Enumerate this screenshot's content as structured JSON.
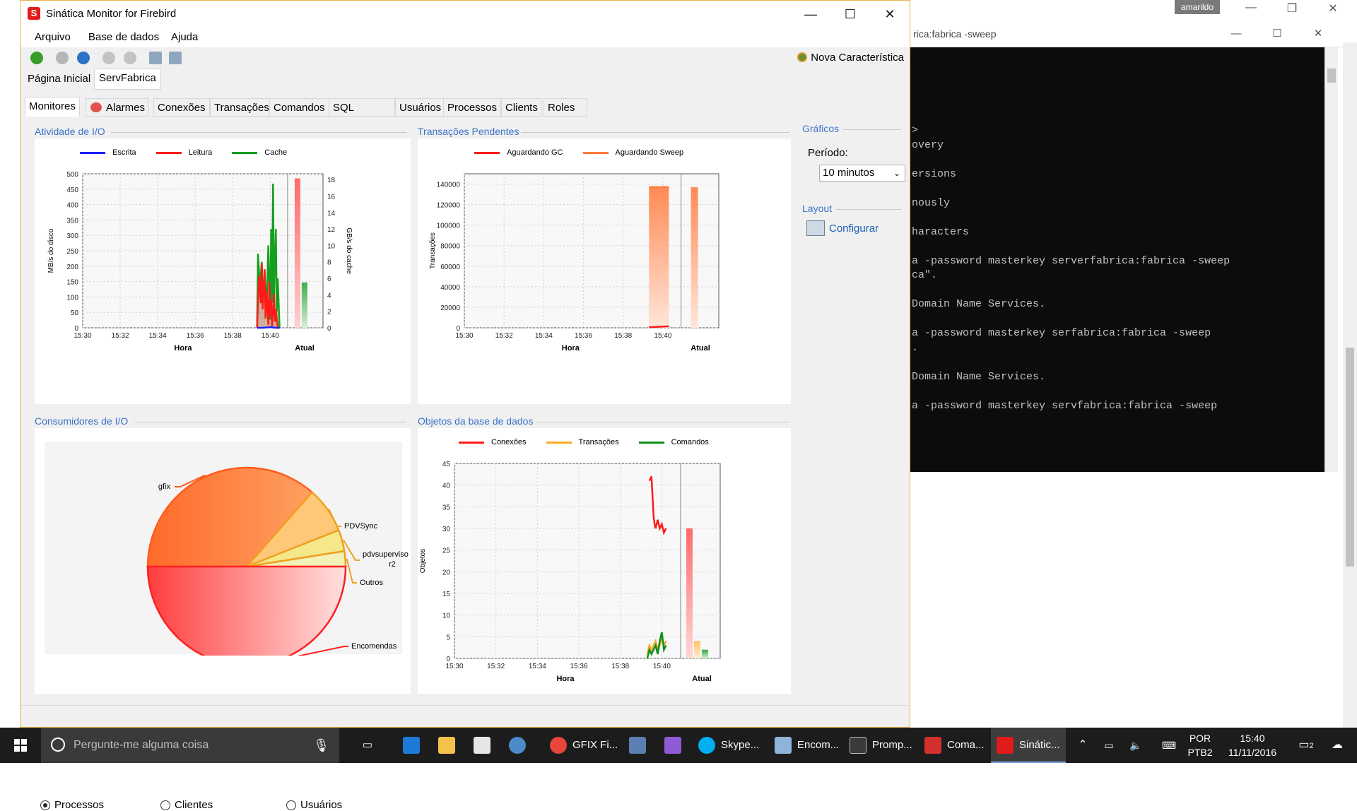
{
  "background": {
    "user_label": "amarildo",
    "console_title": "rica:fabrica -sweep",
    "console_lines": [
      ">",
      "overy",
      "",
      "ersions",
      "",
      "nously",
      "",
      "haracters",
      "",
      "a -password masterkey serverfabrica:fabrica -sweep",
      "ca\".",
      "",
      "Domain Name Services.",
      "",
      "a -password masterkey serfabrica:fabrica -sweep",
      ".",
      "",
      "Domain Name Services.",
      "",
      "a -password masterkey servfabrica:fabrica -sweep"
    ]
  },
  "window": {
    "title": "Sinática Monitor for Firebird",
    "menu": [
      "Arquivo",
      "Base de dados",
      "Ajuda"
    ],
    "nova_caracteristica": "Nova Característica",
    "doc_tabs": [
      "Página Inicial",
      "ServFabrica"
    ],
    "active_doc_tab": "ServFabrica",
    "main_tabs": [
      "Monitores",
      "Alarmes",
      "Conexões",
      "Transações",
      "Comandos",
      "SQL",
      "Usuários",
      "Processos",
      "Clients",
      "Roles"
    ],
    "active_main_tab": "Monitores"
  },
  "colors": {
    "accent_title": "#3c73c8",
    "escrita": "#1d1dff",
    "leitura": "#ff1a1a",
    "cache": "#14a01e",
    "aguardando_gc": "#ff1a1a",
    "aguardando_sweep": "#ff7a3d",
    "conexoes": "#ff1a1a",
    "transacoes": "#ffaa22",
    "comandos": "#0f8f1c"
  },
  "io_activity": {
    "title": "Atividade de I/O",
    "legend": [
      "Escrita",
      "Leitura",
      "Cache"
    ],
    "ylabel": "MB/s do disco",
    "y2label": "GB/s do cache",
    "xlabel": "Hora",
    "atual_label": "Atual"
  },
  "pending_tx": {
    "title": "Transações Pendentes",
    "legend": [
      "Aguardando GC",
      "Aguardando Sweep"
    ],
    "ylabel": "Transações",
    "xlabel": "Hora",
    "atual_label": "Atual"
  },
  "io_consumers": {
    "title": "Consumidores de I/O",
    "radio_options": [
      "Processos",
      "Clientes",
      "Usuários"
    ],
    "selected": "Processos"
  },
  "db_objects": {
    "title": "Objetos da base de dados",
    "legend": [
      "Conexões",
      "Transações",
      "Comandos"
    ],
    "ylabel": "Objetos",
    "xlabel": "Hora",
    "atual_label": "Atual"
  },
  "sidebar": {
    "graficos_title": "Gráficos",
    "periodo_label": "Período:",
    "periodo_value": "10 minutos",
    "layout_title": "Layout",
    "configurar_label": "Configurar"
  },
  "chart_data": [
    {
      "type": "line",
      "title": "Atividade de I/O",
      "xlabel": "Hora",
      "ylabel": "MB/s do disco",
      "y2label": "GB/s do cache",
      "x_ticks": [
        "15:30",
        "15:32",
        "15:34",
        "15:36",
        "15:38",
        "15:40"
      ],
      "y_ticks": [
        0,
        50,
        100,
        150,
        200,
        250,
        300,
        350,
        400,
        450,
        500
      ],
      "y2_ticks": [
        0,
        2,
        4,
        6,
        8,
        10,
        12,
        14,
        16,
        18
      ],
      "ylim": [
        0,
        500
      ],
      "y2lim": [
        0,
        18
      ],
      "xlim_minutes": [
        0,
        11
      ],
      "series": [
        {
          "name": "Escrita",
          "axis": "left",
          "x": [
            9.3,
            9.6,
            10.0,
            10.3,
            10.5
          ],
          "y": [
            0,
            0,
            2,
            0,
            0
          ]
        },
        {
          "name": "Leitura",
          "axis": "left",
          "x": [
            9.3,
            9.4,
            9.5,
            9.55,
            9.6,
            9.7,
            9.75,
            9.8,
            9.9,
            9.95,
            10.0,
            10.05,
            10.1,
            10.2,
            10.25,
            10.3,
            10.4,
            10.5
          ],
          "y": [
            0,
            170,
            80,
            210,
            60,
            190,
            30,
            120,
            10,
            150,
            40,
            90,
            5,
            110,
            20,
            60,
            0,
            0
          ]
        },
        {
          "name": "Cache",
          "axis": "right",
          "x": [
            9.3,
            9.35,
            9.45,
            9.55,
            9.6,
            9.7,
            9.8,
            9.9,
            10.0,
            10.05,
            10.1,
            10.15,
            10.2,
            10.3,
            10.35,
            10.4,
            10.5
          ],
          "y": [
            0,
            9,
            5,
            8,
            3,
            7,
            2,
            10,
            1,
            12,
            3,
            17.5,
            4,
            12,
            2,
            6,
            0
          ]
        }
      ],
      "current": [
        {
          "name": "Leitura",
          "value": 485
        },
        {
          "name": "Cache",
          "value": 5.5
        }
      ]
    },
    {
      "type": "area",
      "title": "Transações Pendentes",
      "xlabel": "Hora",
      "ylabel": "Transações",
      "x_ticks": [
        "15:30",
        "15:32",
        "15:34",
        "15:36",
        "15:38",
        "15:40"
      ],
      "y_ticks": [
        0,
        20000,
        40000,
        60000,
        80000,
        100000,
        120000,
        140000
      ],
      "ylim": [
        0,
        150000
      ],
      "series": [
        {
          "name": "Aguardando GC",
          "x": [
            9.3,
            10.3
          ],
          "y": [
            500,
            1500
          ]
        },
        {
          "name": "Aguardando Sweep",
          "x": [
            9.3,
            10.3
          ],
          "y": [
            137000,
            137000
          ]
        }
      ],
      "current": [
        {
          "name": "Aguardando GC",
          "value": 1000
        },
        {
          "name": "Aguardando Sweep",
          "value": 137000
        }
      ]
    },
    {
      "type": "pie",
      "title": "Consumidores de I/O",
      "slices": [
        {
          "label": "gfix",
          "value": 36.5,
          "color": "#ff7b2e"
        },
        {
          "label": "PDVSync",
          "value": 7.5,
          "color": "#ffc878"
        },
        {
          "label": "pdvsupervisor2",
          "value": 3.5,
          "color": "#f5e88a"
        },
        {
          "label": "Outros",
          "value": 2.5,
          "color": "#f2f2b8"
        },
        {
          "label": "Encomendas",
          "value": 50,
          "color": "#ff4d4d"
        }
      ]
    },
    {
      "type": "line",
      "title": "Objetos da base de dados",
      "xlabel": "Hora",
      "ylabel": "Objetos",
      "x_ticks": [
        "15:30",
        "15:32",
        "15:34",
        "15:36",
        "15:38",
        "15:40"
      ],
      "y_ticks": [
        0,
        5,
        10,
        15,
        20,
        25,
        30,
        35,
        40,
        45
      ],
      "ylim": [
        0,
        45
      ],
      "series": [
        {
          "name": "Conexões",
          "x": [
            9.4,
            9.5,
            9.6,
            9.65,
            9.7,
            9.8,
            9.9,
            10.0,
            10.1,
            10.2
          ],
          "y": [
            41,
            42,
            33,
            31,
            30,
            32,
            30,
            31,
            29,
            30
          ]
        },
        {
          "name": "Transações",
          "x": [
            9.3,
            9.4,
            9.5,
            9.6,
            9.7,
            9.8,
            9.9,
            10.0,
            10.1,
            10.2
          ],
          "y": [
            1,
            3,
            2,
            3,
            4,
            2,
            3,
            5,
            3,
            4
          ]
        },
        {
          "name": "Comandos",
          "x": [
            9.3,
            9.4,
            9.5,
            9.6,
            9.7,
            9.8,
            9.9,
            10.0,
            10.1,
            10.2
          ],
          "y": [
            0,
            2,
            1,
            2,
            3,
            1,
            4,
            6,
            2,
            3
          ]
        }
      ],
      "current": [
        {
          "name": "Conexões",
          "value": 30
        },
        {
          "name": "Transações",
          "value": 4
        },
        {
          "name": "Comandos",
          "value": 2
        }
      ]
    }
  ],
  "taskbar": {
    "search_placeholder": "Pergunte-me alguma coisa",
    "apps": [
      {
        "label": "GFIX Fi...",
        "color": "#e8453c"
      },
      {
        "label": "Skype...",
        "color": "#00aff0"
      },
      {
        "label": "Encom...",
        "color": "#8fb3d9"
      },
      {
        "label": "Promp...",
        "color": "#3a3a3a"
      },
      {
        "label": "Coma...",
        "color": "#d32f2f"
      },
      {
        "label": "Sinátic...",
        "color": "#e21b1b"
      }
    ],
    "lang_top": "POR",
    "lang_bottom": "PTB2",
    "time": "15:40",
    "date": "11/11/2016",
    "notif_count": "2"
  }
}
